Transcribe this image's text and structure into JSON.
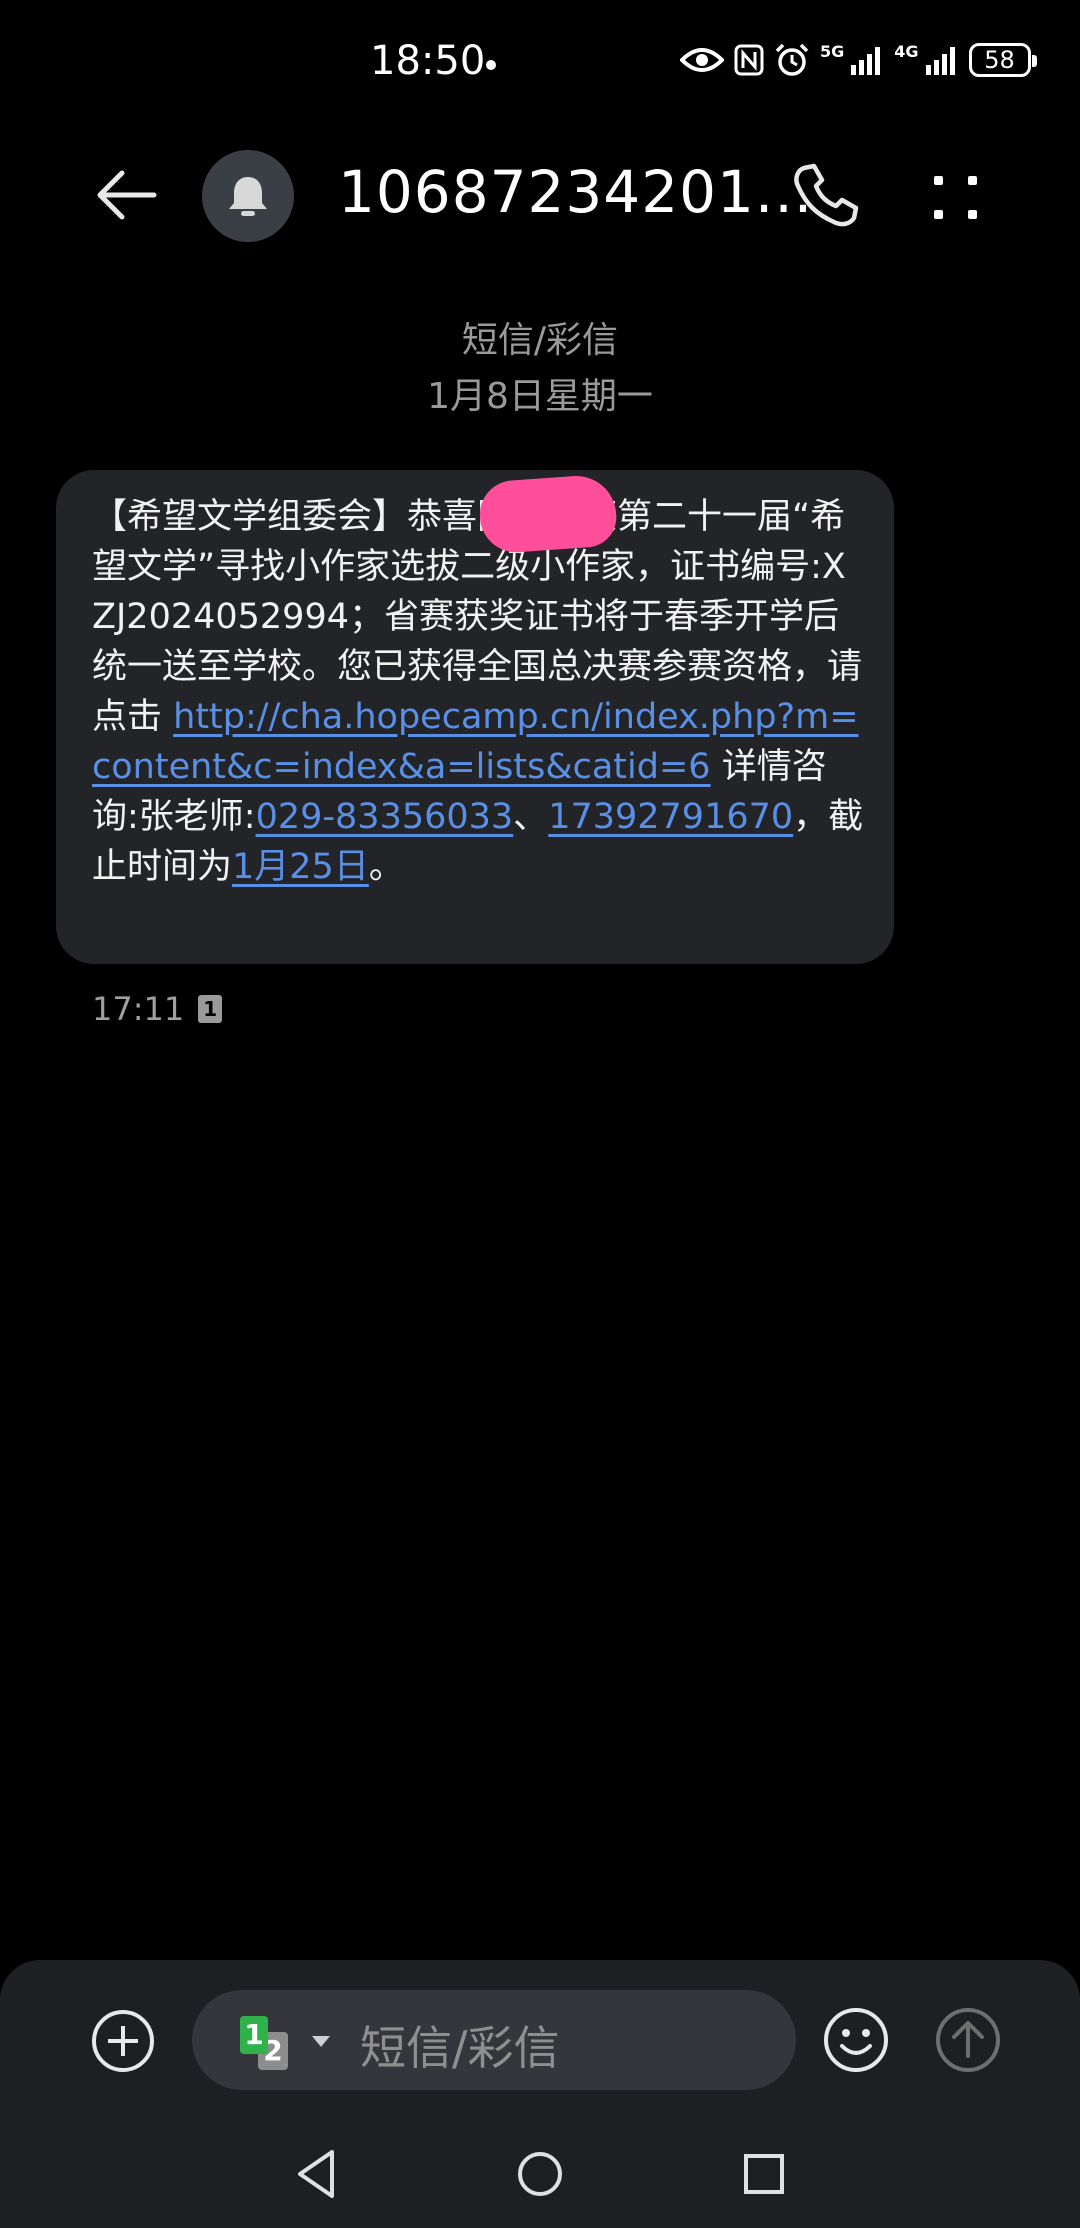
{
  "status_bar": {
    "time": "18:50",
    "network_1": "5G",
    "network_2": "4G",
    "battery": "58"
  },
  "header": {
    "title": "10687234201..."
  },
  "conversation": {
    "type_label": "短信/彩信",
    "date": "1月8日星期一"
  },
  "message": {
    "text_1": "【希望文学组委会】恭喜",
    "text_2": "同学荣获第二十一届“希望文学”寻找小作家选拔二级小作家，证书编号:XZJ2024052994；省赛获奖证书将于春季开学后统一送至学校。您已获得全国总决赛参赛资格，请点击 ",
    "link_url": "http://cha.hopecamp.cn/index.php?m=content&c=index&a=lists&catid=6",
    "text_3": " 详情咨询:张老师:",
    "phone_1": "029-83356033",
    "text_4": "、",
    "phone_2": "17392791670",
    "text_5": "，截止时间为",
    "deadline": "1月25日",
    "text_6": "。",
    "time": "17:11",
    "sim_badge": "1"
  },
  "compose": {
    "sim_primary": "1",
    "sim_secondary": "2",
    "placeholder": "短信/彩信"
  },
  "colors": {
    "background": "#000000",
    "bubble": "#232428",
    "link": "#5a8fe6",
    "redaction": "#ff4f9a",
    "sim1": "#2fb24a"
  }
}
